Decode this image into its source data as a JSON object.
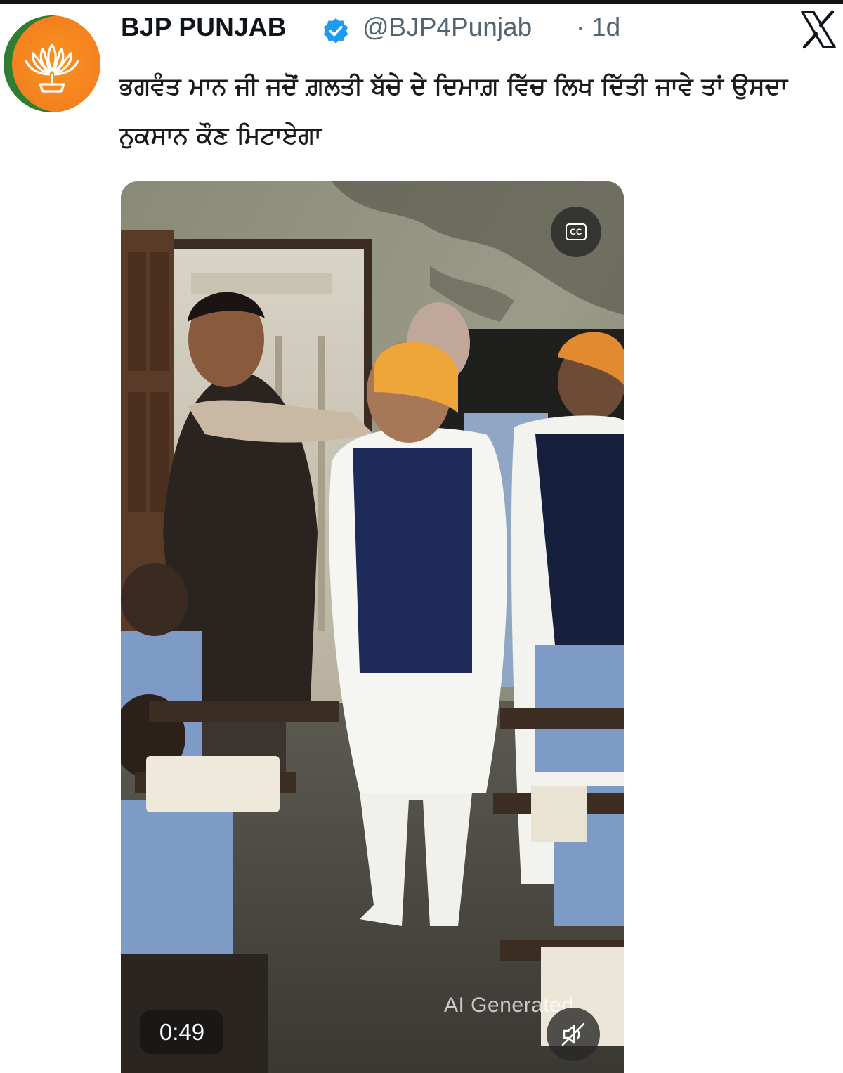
{
  "post": {
    "author_name": "BJP PUNJAB",
    "handle": "@BJP4Punjab",
    "separator": "·",
    "time": "1d",
    "text": "ਭਗਵੰਤ ਮਾਨ ਜੀ ਜਦੋਂ ਗ਼ਲਤੀ ਬੱਚੇ ਦੇ ਦਿਮਾਗ਼ ਵਿੱਚ ਲਿਖ ਦਿੱਤੀ ਜਾਵੇ ਤਾਂ ਉਸਦਾ ਨੁਕਸਾਨ ਕੌਣ ਮਿਟਾਏਗਾ"
  },
  "icons": {
    "avatar": "bjp-lotus-logo",
    "verified": "verified-badge-icon",
    "platform": "x-logo-icon",
    "captions": "cc-icon",
    "mute": "speaker-muted-icon"
  },
  "video": {
    "duration": "0:49",
    "captions_label": "CC",
    "watermark": "AI Generated"
  },
  "colors": {
    "avatar_orange": "#f58220",
    "avatar_green": "#2e7d32",
    "verified_blue": "#1d9bf0",
    "handle_gray": "#536471"
  }
}
